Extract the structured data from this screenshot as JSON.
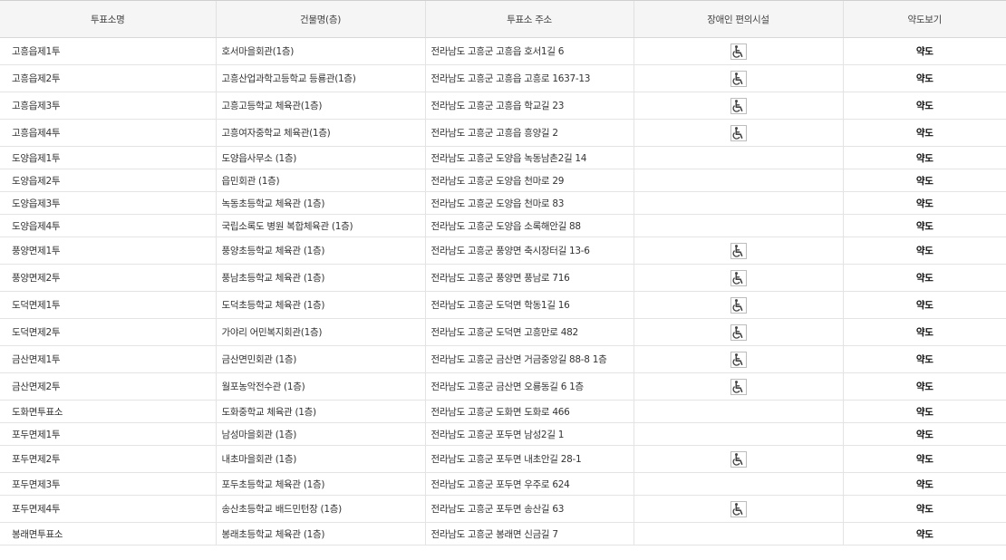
{
  "table": {
    "headers": [
      "투표소명",
      "건물명(층)",
      "투표소 주소",
      "장애인 편의시설",
      "약도보기"
    ],
    "map_label": "약도",
    "accessible_icon": "wheelchair-icon",
    "rows": [
      {
        "name": "고흥읍제1투",
        "building": "호서마을회관(1층)",
        "address": "전라남도 고흥군 고흥읍 호서1길 6",
        "accessible": true
      },
      {
        "name": "고흥읍제2투",
        "building": "고흥산업과학고등학교 등룡관(1층)",
        "address": "전라남도 고흥군 고흥읍 고흥로 1637-13",
        "accessible": true
      },
      {
        "name": "고흥읍제3투",
        "building": "고흥고등학교 체육관(1층)",
        "address": "전라남도 고흥군 고흥읍 학교길 23",
        "accessible": true
      },
      {
        "name": "고흥읍제4투",
        "building": "고흥여자중학교 체육관(1층)",
        "address": "전라남도 고흥군 고흥읍 흥양길 2",
        "accessible": true
      },
      {
        "name": "도양읍제1투",
        "building": "도양읍사무소 (1층)",
        "address": "전라남도 고흥군 도양읍 녹동남촌2길 14",
        "accessible": false
      },
      {
        "name": "도양읍제2투",
        "building": "읍민회관 (1층)",
        "address": "전라남도 고흥군 도양읍 천마로 29",
        "accessible": false
      },
      {
        "name": "도양읍제3투",
        "building": "녹동초등학교 체육관 (1층)",
        "address": "전라남도 고흥군 도양읍 천마로 83",
        "accessible": false
      },
      {
        "name": "도양읍제4투",
        "building": "국립소록도 병원 복합체육관 (1층)",
        "address": "전라남도 고흥군 도양읍 소록해안길 88",
        "accessible": false
      },
      {
        "name": "풍양면제1투",
        "building": "풍양초등학교 체육관 (1층)",
        "address": "전라남도 고흥군 풍양면 축시장터길 13-6",
        "accessible": true
      },
      {
        "name": "풍양면제2투",
        "building": "풍남초등학교 체육관 (1층)",
        "address": "전라남도 고흥군 풍양면 풍남로 716",
        "accessible": true
      },
      {
        "name": "도덕면제1투",
        "building": "도덕초등학교 체육관 (1층)",
        "address": "전라남도 고흥군 도덕면 학동1길 16",
        "accessible": true
      },
      {
        "name": "도덕면제2투",
        "building": "가야리 어민복지회관(1층)",
        "address": "전라남도 고흥군 도덕면 고흥만로 482",
        "accessible": true
      },
      {
        "name": "금산면제1투",
        "building": "금산면민회관 (1층)",
        "address": "전라남도 고흥군 금산면 거금중앙길 88-8 1층",
        "accessible": true
      },
      {
        "name": "금산면제2투",
        "building": "월포농악전수관 (1층)",
        "address": "전라남도 고흥군 금산면 오룡동길 6 1층",
        "accessible": true
      },
      {
        "name": "도화면투표소",
        "building": "도화중학교 체육관 (1층)",
        "address": "전라남도 고흥군 도화면 도화로 466",
        "accessible": false
      },
      {
        "name": "포두면제1투",
        "building": "남성마을회관 (1층)",
        "address": "전라남도 고흥군 포두면 남성2길 1",
        "accessible": false
      },
      {
        "name": "포두면제2투",
        "building": "내초마을회관 (1층)",
        "address": "전라남도 고흥군 포두면 내초안길 28-1",
        "accessible": true
      },
      {
        "name": "포두면제3투",
        "building": "포두초등학교 체육관 (1층)",
        "address": "전라남도 고흥군 포두면 우주로 624",
        "accessible": false
      },
      {
        "name": "포두면제4투",
        "building": "송산초등학교 배드민턴장 (1층)",
        "address": "전라남도 고흥군 포두면 송산길 63",
        "accessible": true
      },
      {
        "name": "봉래면투표소",
        "building": "봉래초등학교 체육관 (1층)",
        "address": "전라남도 고흥군 봉래면 신금길 7",
        "accessible": false
      }
    ]
  }
}
